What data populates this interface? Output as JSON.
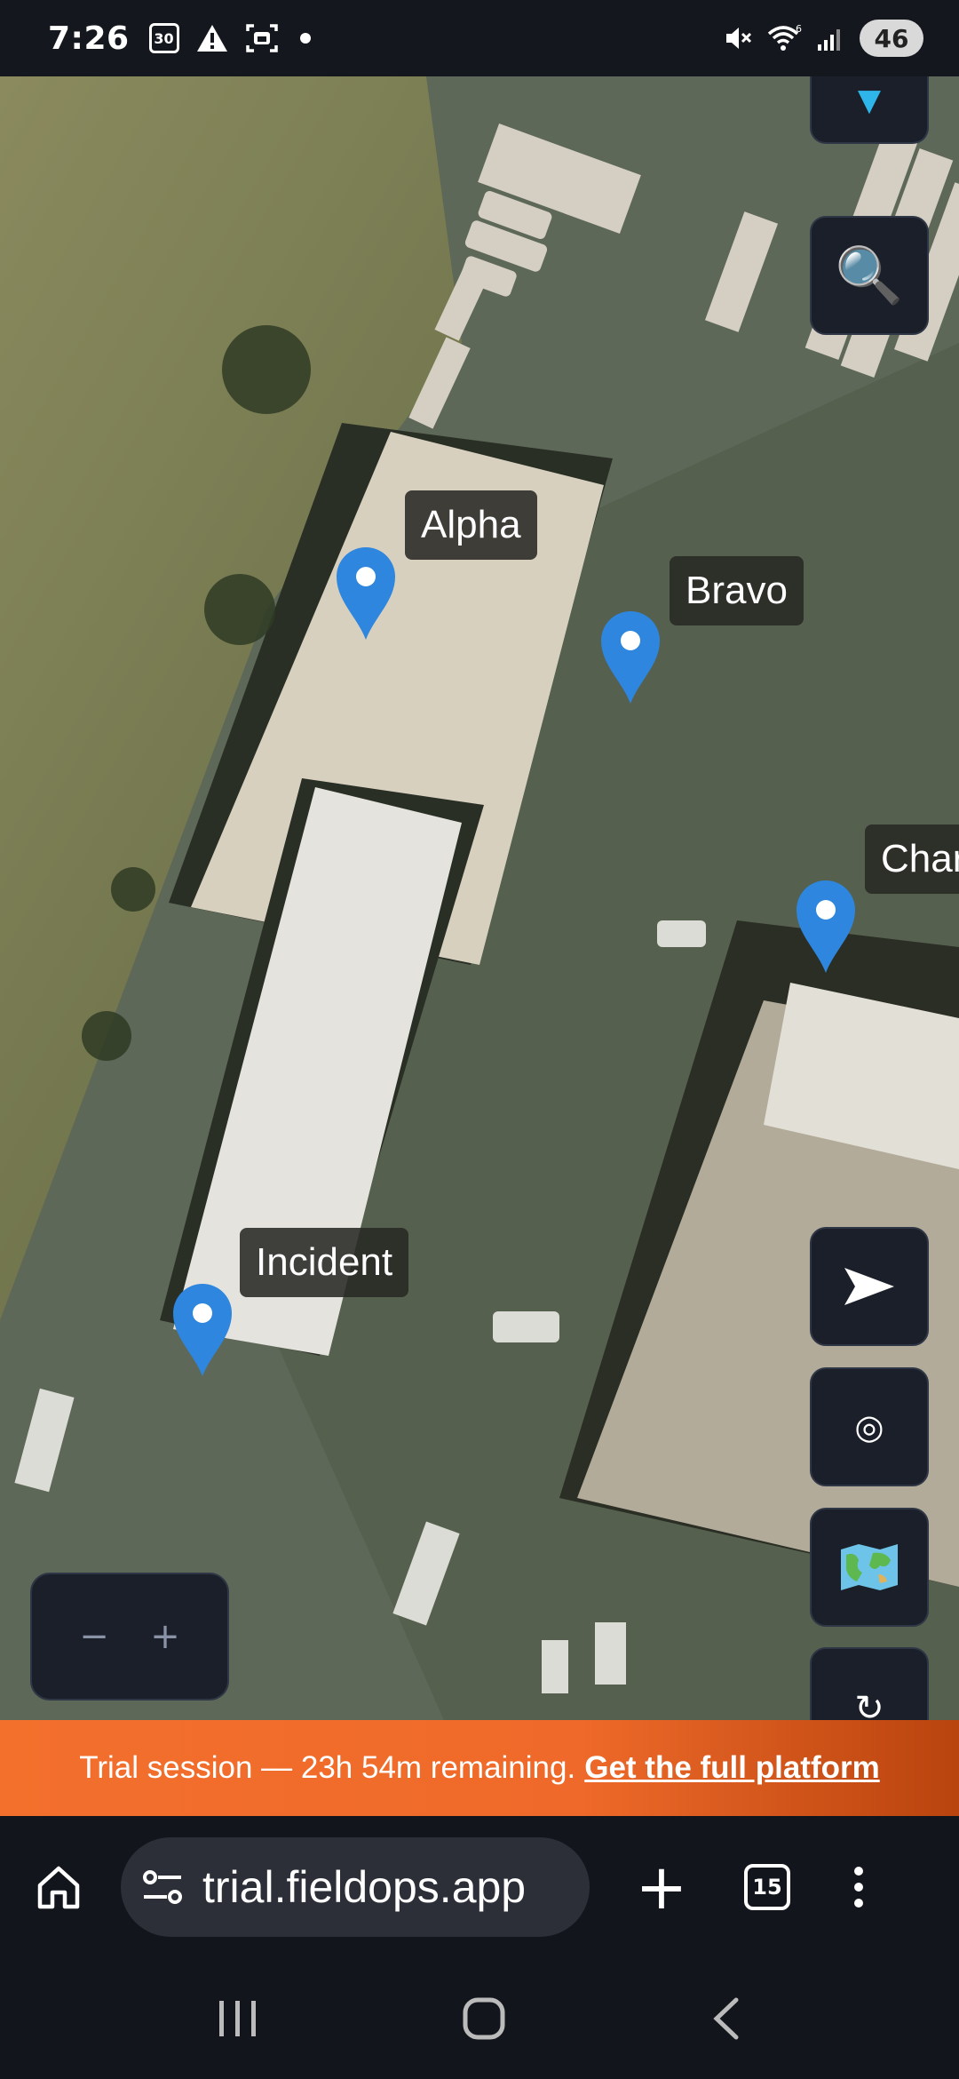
{
  "status_bar": {
    "time": "7:26",
    "calendar_day": "30",
    "battery": "46",
    "icons": [
      "calendar-icon",
      "warning-icon",
      "screenshot-icon",
      "notification-dot",
      "mute-icon",
      "wifi-6-icon",
      "signal-icon",
      "battery-icon"
    ]
  },
  "map": {
    "markers": [
      {
        "label": "Alpha"
      },
      {
        "label": "Bravo"
      },
      {
        "label": "Char"
      },
      {
        "label": "Incident"
      }
    ],
    "marker_color": "#2e86de",
    "marker_count": "4",
    "controls": {
      "collapse_icon": "▼",
      "search_icon": "🔍",
      "navigate_icon": "➤",
      "locate_icon": "◎",
      "layers_icon": "🗺",
      "refresh_icon": "↻",
      "zoom_out": "−",
      "zoom_in": "+",
      "marker_count_icon": "📍"
    }
  },
  "banner": {
    "text": "Trial session — 23h 54m remaining.",
    "link": "Get the full platform",
    "colors": [
      "#f36f2c",
      "#b9440e"
    ]
  },
  "browser": {
    "url": "trial.fieldops.app",
    "tab_count": "15",
    "plus": "+"
  }
}
